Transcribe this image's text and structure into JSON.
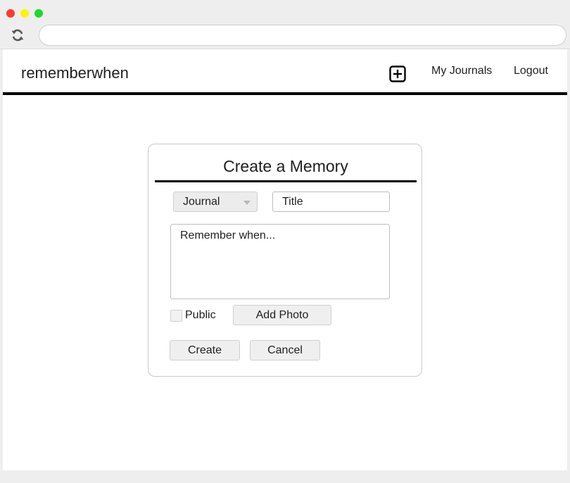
{
  "browser": {
    "url": "",
    "reload_icon": "reload-icon"
  },
  "header": {
    "brand": "rememberwhen",
    "add_icon": "plus-square-icon",
    "nav": {
      "journals": "My Journals",
      "logout": "Logout"
    }
  },
  "form": {
    "title": "Create a Memory",
    "journal_select": {
      "selected": "Journal"
    },
    "title_field": {
      "placeholder": "Title",
      "value": ""
    },
    "body_field": {
      "placeholder": "Remember when...",
      "value": ""
    },
    "public_checkbox": {
      "label": "Public",
      "checked": false
    },
    "add_photo_label": "Add Photo",
    "create_label": "Create",
    "cancel_label": "Cancel"
  },
  "colors": {
    "accent_rule": "#000000",
    "button_bg": "#efefef",
    "traffic_red": "#fe3b30",
    "traffic_yellow": "#fff200",
    "traffic_green": "#1fd82a"
  }
}
